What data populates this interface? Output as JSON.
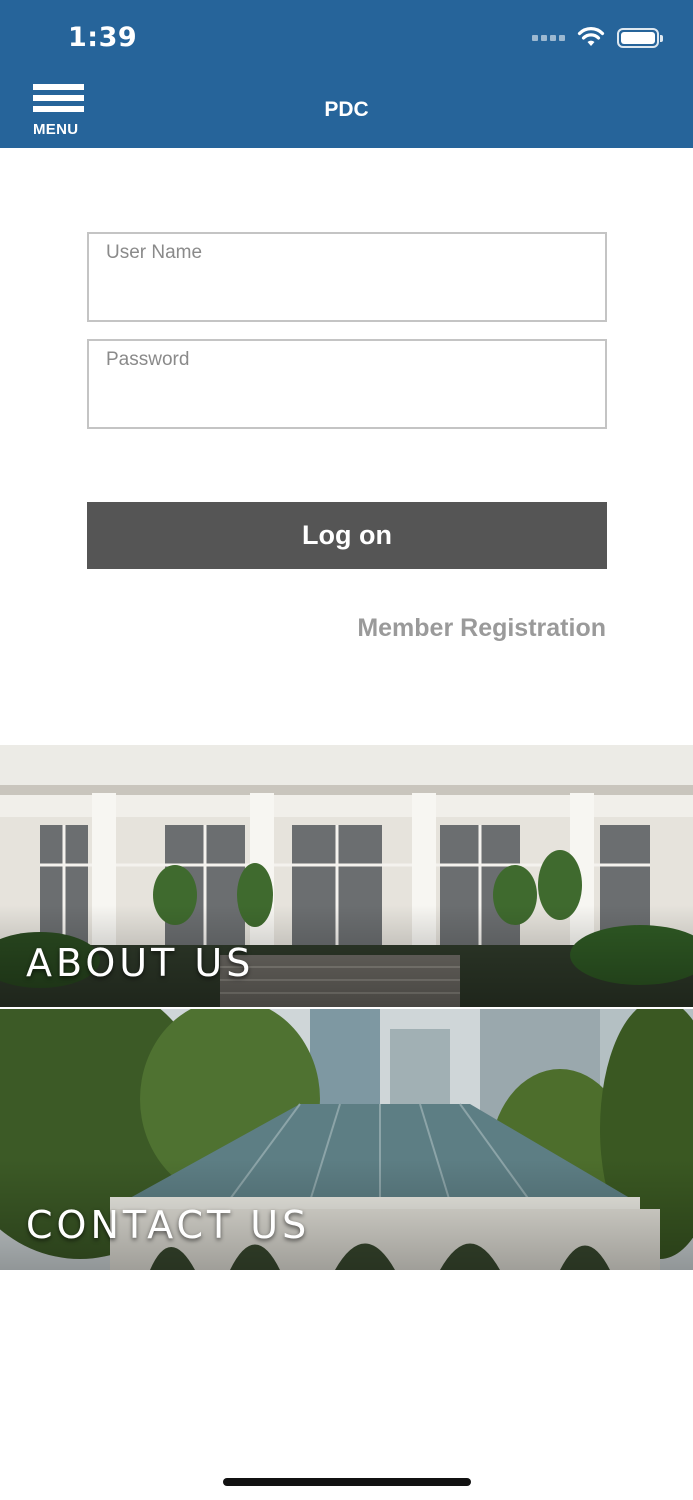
{
  "status_bar": {
    "time": "1:39",
    "wifi_icon": "wifi-icon",
    "battery_icon": "battery-icon"
  },
  "header": {
    "menu_label": "MENU",
    "menu_icon": "hamburger-icon",
    "title": "PDC",
    "background": "#26649a"
  },
  "login": {
    "username_placeholder": "User Name",
    "username_value": "",
    "password_placeholder": "Password",
    "password_value": "",
    "logon_label": "Log on",
    "register_label": "Member Registration"
  },
  "tiles": [
    {
      "label": "ABOUT US"
    },
    {
      "label": "CONTACT US"
    }
  ]
}
